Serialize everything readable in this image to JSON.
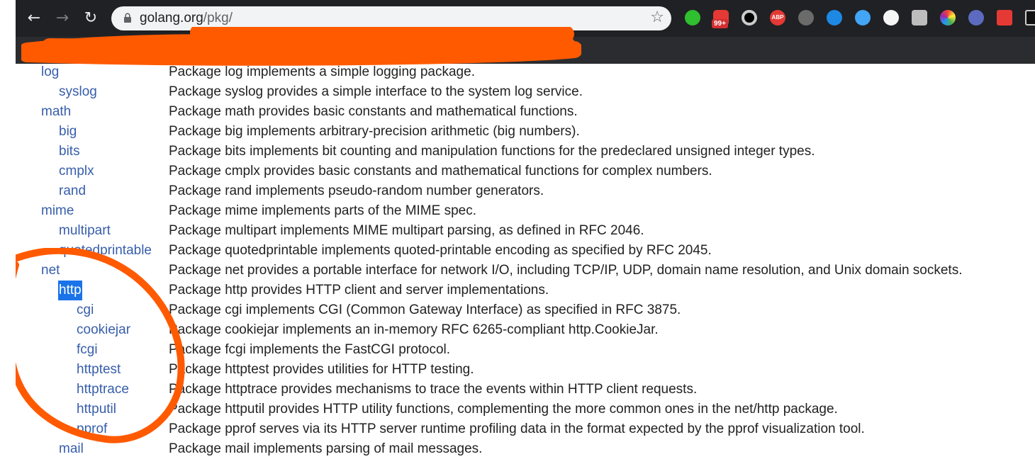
{
  "browser": {
    "url_host": "golang.org",
    "url_path": "/pkg/",
    "nav_icons": [
      "back-arrow-icon",
      "forward-arrow-icon",
      "reload-icon"
    ],
    "extension_badge": "99+",
    "extension_badge_color": "#d32f2f",
    "abp_label": "ABP"
  },
  "colors": {
    "link": "#375eab",
    "text": "#222222",
    "selection": "#1a73e8",
    "annotation": "#ff5a00"
  },
  "packages": [
    {
      "name": "log",
      "level": 0,
      "desc": "Package log implements a simple logging package."
    },
    {
      "name": "syslog",
      "level": 1,
      "desc": "Package syslog provides a simple interface to the system log service."
    },
    {
      "name": "math",
      "level": 0,
      "desc": "Package math provides basic constants and mathematical functions."
    },
    {
      "name": "big",
      "level": 1,
      "desc": "Package big implements arbitrary-precision arithmetic (big numbers)."
    },
    {
      "name": "bits",
      "level": 1,
      "desc": "Package bits implements bit counting and manipulation functions for the predeclared unsigned integer types."
    },
    {
      "name": "cmplx",
      "level": 1,
      "desc": "Package cmplx provides basic constants and mathematical functions for complex numbers."
    },
    {
      "name": "rand",
      "level": 1,
      "desc": "Package rand implements pseudo-random number generators."
    },
    {
      "name": "mime",
      "level": 0,
      "desc": "Package mime implements parts of the MIME spec."
    },
    {
      "name": "multipart",
      "level": 1,
      "desc": "Package multipart implements MIME multipart parsing, as defined in RFC 2046."
    },
    {
      "name": "quotedprintable",
      "level": 1,
      "desc": "Package quotedprintable implements quoted-printable encoding as specified by RFC 2045."
    },
    {
      "name": "net",
      "level": 0,
      "desc": "Package net provides a portable interface for network I/O, including TCP/IP, UDP, domain name resolution, and Unix domain sockets."
    },
    {
      "name": "http",
      "level": 1,
      "selected": true,
      "desc": "Package http provides HTTP client and server implementations."
    },
    {
      "name": "cgi",
      "level": 2,
      "desc": "Package cgi implements CGI (Common Gateway Interface) as specified in RFC 3875."
    },
    {
      "name": "cookiejar",
      "level": 2,
      "desc": "Package cookiejar implements an in-memory RFC 6265-compliant http.CookieJar."
    },
    {
      "name": "fcgi",
      "level": 2,
      "desc": "Package fcgi implements the FastCGI protocol."
    },
    {
      "name": "httptest",
      "level": 2,
      "desc": "Package httptest provides utilities for HTTP testing."
    },
    {
      "name": "httptrace",
      "level": 2,
      "desc": "Package httptrace provides mechanisms to trace the events within HTTP client requests."
    },
    {
      "name": "httputil",
      "level": 2,
      "desc": "Package httputil provides HTTP utility functions, complementing the more common ones in the net/http package."
    },
    {
      "name": "pprof",
      "level": 2,
      "desc": "Package pprof serves via its HTTP server runtime profiling data in the format expected by the pprof visualization tool."
    },
    {
      "name": "mail",
      "level": 1,
      "desc": "Package mail implements parsing of mail messages."
    }
  ]
}
